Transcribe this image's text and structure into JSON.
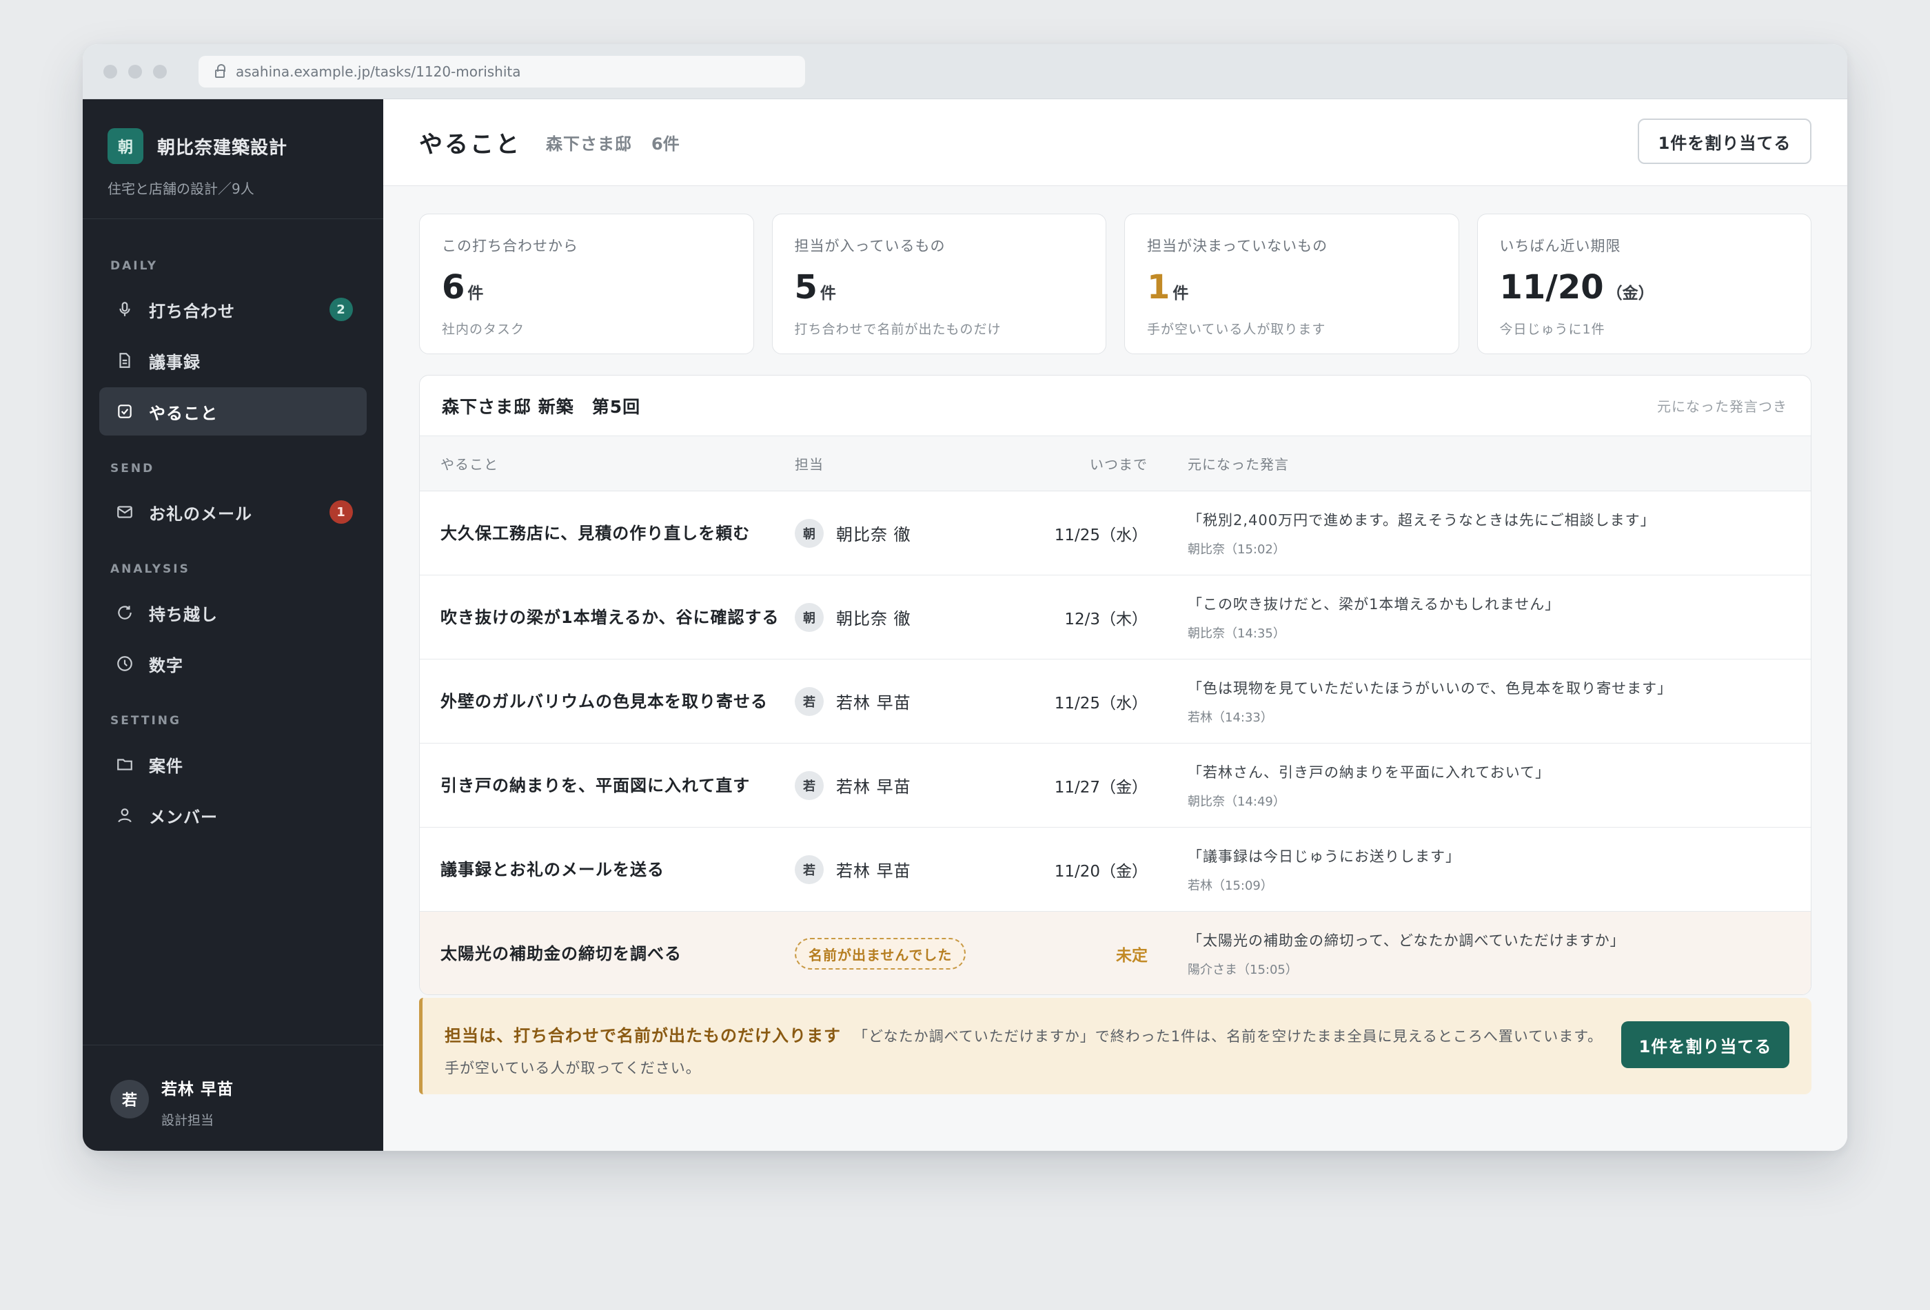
{
  "browser": {
    "url": "asahina.example.jp/tasks/1120-morishita"
  },
  "brand": {
    "logo": "朝",
    "name": "朝比奈建築設計",
    "subtitle": "住宅と店舗の設計／9人"
  },
  "nav": {
    "sections": [
      "DAILY",
      "SEND",
      "ANALYSIS",
      "SETTING"
    ],
    "items": [
      {
        "label": "打ち合わせ",
        "icon": "microphone-icon",
        "badge": "2"
      },
      {
        "label": "議事録",
        "icon": "document-icon"
      },
      {
        "label": "やること",
        "icon": "checkbox-icon"
      },
      {
        "label": "お礼のメール",
        "icon": "mail-icon",
        "badge": "1"
      },
      {
        "label": "持ち越し",
        "icon": "refresh-icon"
      },
      {
        "label": "数字",
        "icon": "clock-icon"
      },
      {
        "label": "案件",
        "icon": "folder-icon"
      },
      {
        "label": "メンバー",
        "icon": "person-icon"
      }
    ]
  },
  "user": {
    "avatar": "若",
    "name": "若林 早苗",
    "role": "設計担当"
  },
  "header": {
    "title": "やること",
    "project": "森下さま邸",
    "count": "6件",
    "assign_button": "1件を割り当てる"
  },
  "stats": [
    {
      "label": "この打ち合わせから",
      "value": "6",
      "unit": "件",
      "note": "社内のタスク"
    },
    {
      "label": "担当が入っているもの",
      "value": "5",
      "unit": "件",
      "note": "打ち合わせで名前が出たものだけ"
    },
    {
      "label": "担当が決まっていないもの",
      "value": "1",
      "unit": "件",
      "note": "手が空いている人が取ります"
    },
    {
      "label": "いちばん近い期限",
      "value": "11/20",
      "unit": "（金）",
      "note": "今日じゅうに1件"
    }
  ],
  "panel": {
    "title": "森下さま邸 新築　第5回",
    "note": "元になった発言つき",
    "columns": {
      "task": "やること",
      "owner": "担当",
      "due": "いつまで",
      "source": "元になった発言"
    },
    "rows": [
      {
        "task": "大久保工務店に、見積の作り直しを頼む",
        "avatar": "朝",
        "owner": "朝比奈 徹",
        "due": "11/25（水）",
        "quote": "「税別2,400万円で進めます。超えそうなときは先にご相談します」",
        "meta": "朝比奈（15:02）"
      },
      {
        "task": "吹き抜けの梁が1本増えるか、谷に確認する",
        "avatar": "朝",
        "owner": "朝比奈 徹",
        "due": "12/3（木）",
        "quote": "「この吹き抜けだと、梁が1本増えるかもしれません」",
        "meta": "朝比奈（14:35）"
      },
      {
        "task": "外壁のガルバリウムの色見本を取り寄せる",
        "avatar": "若",
        "owner": "若林 早苗",
        "due": "11/25（水）",
        "quote": "「色は現物を見ていただいたほうがいいので、色見本を取り寄せます」",
        "meta": "若林（14:33）"
      },
      {
        "task": "引き戸の納まりを、平面図に入れて直す",
        "avatar": "若",
        "owner": "若林 早苗",
        "due": "11/27（金）",
        "quote": "「若林さん、引き戸の納まりを平面に入れておいて」",
        "meta": "朝比奈（14:49）"
      },
      {
        "task": "議事録とお礼のメールを送る",
        "avatar": "若",
        "owner": "若林 早苗",
        "due": "11/20（金）",
        "quote": "「議事録は今日じゅうにお送りします」",
        "meta": "若林（15:09）"
      },
      {
        "task": "太陽光の補助金の締切を調べる",
        "owner_tag": "名前が出ませんでした",
        "due": "未定",
        "quote": "「太陽光の補助金の締切って、どなたか調べていただけますか」",
        "meta": "陽介さま（15:05）"
      }
    ]
  },
  "notice": {
    "strong": "担当は、打ち合わせで名前が出たものだけ入ります",
    "text": "「どなたか調べていただけますか」で終わった1件は、名前を空けたまま全員に見えるところへ置いています。手が空いている人が取ってください。",
    "button": "1件を割り当てる"
  },
  "colors": {
    "sidebar": "#1e2229",
    "brand": "#1f7468",
    "accent": "#c28a26",
    "danger": "#b23a2c",
    "primary_button": "#1d6659"
  }
}
